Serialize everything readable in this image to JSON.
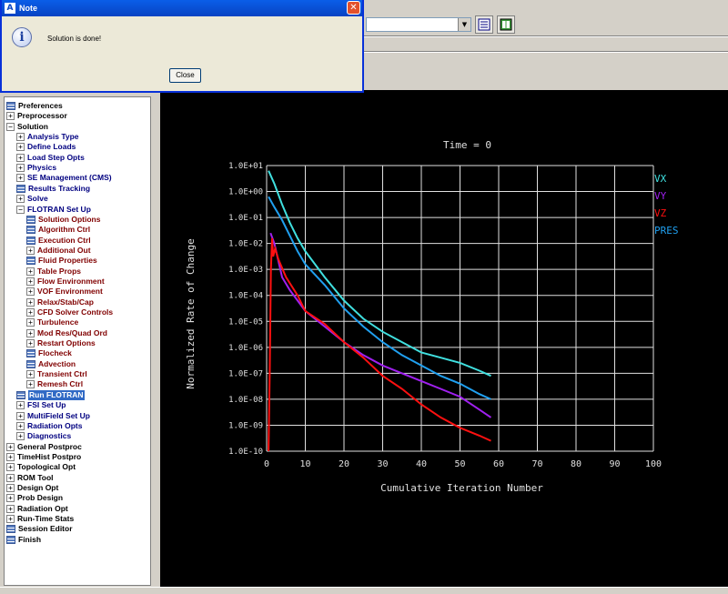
{
  "dialog": {
    "title": "Note",
    "icon": "info-icon",
    "message": "Solution is done!",
    "close_label": "Close"
  },
  "tree": {
    "items": [
      {
        "label": "Preferences",
        "indent": 0,
        "kind": "leaf",
        "color": "black"
      },
      {
        "label": "Preprocessor",
        "indent": 0,
        "kind": "plus",
        "color": "black"
      },
      {
        "label": "Solution",
        "indent": 0,
        "kind": "minus",
        "color": "black"
      },
      {
        "label": "Analysis Type",
        "indent": 1,
        "kind": "plus",
        "color": "navy"
      },
      {
        "label": "Define Loads",
        "indent": 1,
        "kind": "plus",
        "color": "navy"
      },
      {
        "label": "Load Step Opts",
        "indent": 1,
        "kind": "plus",
        "color": "navy"
      },
      {
        "label": "Physics",
        "indent": 1,
        "kind": "plus",
        "color": "navy"
      },
      {
        "label": "SE Management (CMS)",
        "indent": 1,
        "kind": "plus",
        "color": "navy"
      },
      {
        "label": "Results Tracking",
        "indent": 1,
        "kind": "leaf",
        "color": "navy"
      },
      {
        "label": "Solve",
        "indent": 1,
        "kind": "plus",
        "color": "navy"
      },
      {
        "label": "FLOTRAN Set Up",
        "indent": 1,
        "kind": "minus",
        "color": "navy"
      },
      {
        "label": "Solution Options",
        "indent": 2,
        "kind": "leaf",
        "color": "maroon"
      },
      {
        "label": "Algorithm Ctrl",
        "indent": 2,
        "kind": "leaf",
        "color": "maroon"
      },
      {
        "label": "Execution Ctrl",
        "indent": 2,
        "kind": "leaf",
        "color": "maroon"
      },
      {
        "label": "Additional Out",
        "indent": 2,
        "kind": "plus",
        "color": "maroon"
      },
      {
        "label": "Fluid Properties",
        "indent": 2,
        "kind": "leaf",
        "color": "maroon"
      },
      {
        "label": "Table Props",
        "indent": 2,
        "kind": "plus",
        "color": "maroon"
      },
      {
        "label": "Flow Environment",
        "indent": 2,
        "kind": "plus",
        "color": "maroon"
      },
      {
        "label": "VOF Environment",
        "indent": 2,
        "kind": "plus",
        "color": "maroon"
      },
      {
        "label": "Relax/Stab/Cap",
        "indent": 2,
        "kind": "plus",
        "color": "maroon"
      },
      {
        "label": "CFD Solver Controls",
        "indent": 2,
        "kind": "plus",
        "color": "maroon"
      },
      {
        "label": "Turbulence",
        "indent": 2,
        "kind": "plus",
        "color": "maroon"
      },
      {
        "label": "Mod Res/Quad Ord",
        "indent": 2,
        "kind": "plus",
        "color": "maroon"
      },
      {
        "label": "Restart Options",
        "indent": 2,
        "kind": "plus",
        "color": "maroon"
      },
      {
        "label": "Flocheck",
        "indent": 2,
        "kind": "leaf",
        "color": "maroon"
      },
      {
        "label": "Advection",
        "indent": 2,
        "kind": "leaf",
        "color": "maroon"
      },
      {
        "label": "Transient Ctrl",
        "indent": 2,
        "kind": "plus",
        "color": "maroon"
      },
      {
        "label": "Remesh Ctrl",
        "indent": 2,
        "kind": "plus",
        "color": "maroon"
      },
      {
        "label": "Run FLOTRAN",
        "indent": 1,
        "kind": "leaf",
        "color": "navy",
        "selected": true
      },
      {
        "label": "FSI Set Up",
        "indent": 1,
        "kind": "plus",
        "color": "navy"
      },
      {
        "label": "MultiField Set Up",
        "indent": 1,
        "kind": "plus",
        "color": "navy"
      },
      {
        "label": "Radiation Opts",
        "indent": 1,
        "kind": "plus",
        "color": "navy"
      },
      {
        "label": "Diagnostics",
        "indent": 1,
        "kind": "plus",
        "color": "navy"
      },
      {
        "label": "General Postproc",
        "indent": 0,
        "kind": "plus",
        "color": "black"
      },
      {
        "label": "TimeHist Postpro",
        "indent": 0,
        "kind": "plus",
        "color": "black"
      },
      {
        "label": "Topological Opt",
        "indent": 0,
        "kind": "plus",
        "color": "black"
      },
      {
        "label": "ROM Tool",
        "indent": 0,
        "kind": "plus",
        "color": "black"
      },
      {
        "label": "Design Opt",
        "indent": 0,
        "kind": "plus",
        "color": "black"
      },
      {
        "label": "Prob Design",
        "indent": 0,
        "kind": "plus",
        "color": "black"
      },
      {
        "label": "Radiation Opt",
        "indent": 0,
        "kind": "plus",
        "color": "black"
      },
      {
        "label": "Run-Time Stats",
        "indent": 0,
        "kind": "plus",
        "color": "black"
      },
      {
        "label": "Session Editor",
        "indent": 0,
        "kind": "leaf",
        "color": "black"
      },
      {
        "label": "Finish",
        "indent": 0,
        "kind": "leaf",
        "color": "black"
      }
    ]
  },
  "chart_data": {
    "type": "line",
    "title": "Time = 0",
    "xlabel": "Cumulative Iteration Number",
    "ylabel": "Normalized Rate of Change",
    "xlim": [
      0,
      100
    ],
    "ylim_log10": [
      -10,
      1
    ],
    "x_ticks": [
      "0",
      "10",
      "20",
      "30",
      "40",
      "50",
      "60",
      "70",
      "80",
      "90",
      "100"
    ],
    "y_ticks": [
      "1.0E-10",
      "1.0E-09",
      "1.0E-08",
      "1.0E-07",
      "1.0E-06",
      "1.0E-05",
      "1.0E-04",
      "1.0E-03",
      "1.0E-02",
      "1.0E-01",
      "1.0E+00",
      "1.0E+01"
    ],
    "grid": true,
    "legend_position": "right",
    "background": "#000000",
    "series": [
      {
        "name": "VX",
        "color": "#40e0e0",
        "points": [
          [
            0.5,
            0.8
          ],
          [
            2,
            0.3
          ],
          [
            4,
            -0.5
          ],
          [
            6,
            -1.2
          ],
          [
            8,
            -1.8
          ],
          [
            10,
            -2.3
          ],
          [
            15,
            -3.3
          ],
          [
            20,
            -4.2
          ],
          [
            25,
            -4.9
          ],
          [
            30,
            -5.4
          ],
          [
            35,
            -5.8
          ],
          [
            40,
            -6.2
          ],
          [
            45,
            -6.4
          ],
          [
            50,
            -6.6
          ],
          [
            55,
            -6.9
          ],
          [
            58,
            -7.1
          ]
        ]
      },
      {
        "name": "VY",
        "color": "#a020f0",
        "points": [
          [
            1,
            -1.6
          ],
          [
            2,
            -2.0
          ],
          [
            4,
            -3.3
          ],
          [
            6,
            -3.8
          ],
          [
            8,
            -4.2
          ],
          [
            10,
            -4.6
          ],
          [
            15,
            -5.2
          ],
          [
            20,
            -5.8
          ],
          [
            25,
            -6.3
          ],
          [
            30,
            -6.7
          ],
          [
            35,
            -7.0
          ],
          [
            40,
            -7.3
          ],
          [
            45,
            -7.6
          ],
          [
            50,
            -7.9
          ],
          [
            55,
            -8.4
          ],
          [
            58,
            -8.7
          ]
        ]
      },
      {
        "name": "VZ",
        "color": "#ff1010",
        "points": [
          [
            0.5,
            -10
          ],
          [
            0.8,
            -7
          ],
          [
            1.1,
            -3
          ],
          [
            1.4,
            -1.8
          ],
          [
            1.7,
            -2.5
          ],
          [
            2.2,
            -2.2
          ],
          [
            3,
            -2.6
          ],
          [
            5,
            -3.3
          ],
          [
            8,
            -4.0
          ],
          [
            10,
            -4.6
          ],
          [
            15,
            -5.1
          ],
          [
            20,
            -5.8
          ],
          [
            25,
            -6.4
          ],
          [
            30,
            -7.1
          ],
          [
            35,
            -7.6
          ],
          [
            40,
            -8.2
          ],
          [
            45,
            -8.7
          ],
          [
            50,
            -9.1
          ],
          [
            55,
            -9.4
          ],
          [
            58,
            -9.6
          ]
        ]
      },
      {
        "name": "PRES",
        "color": "#20a0f0",
        "points": [
          [
            0.5,
            -0.2
          ],
          [
            2,
            -0.6
          ],
          [
            4,
            -1.1
          ],
          [
            6,
            -1.7
          ],
          [
            8,
            -2.3
          ],
          [
            10,
            -2.8
          ],
          [
            15,
            -3.6
          ],
          [
            20,
            -4.5
          ],
          [
            25,
            -5.2
          ],
          [
            30,
            -5.8
          ],
          [
            35,
            -6.3
          ],
          [
            40,
            -6.7
          ],
          [
            45,
            -7.1
          ],
          [
            50,
            -7.4
          ],
          [
            55,
            -7.8
          ],
          [
            58,
            -8.0
          ]
        ]
      }
    ]
  }
}
